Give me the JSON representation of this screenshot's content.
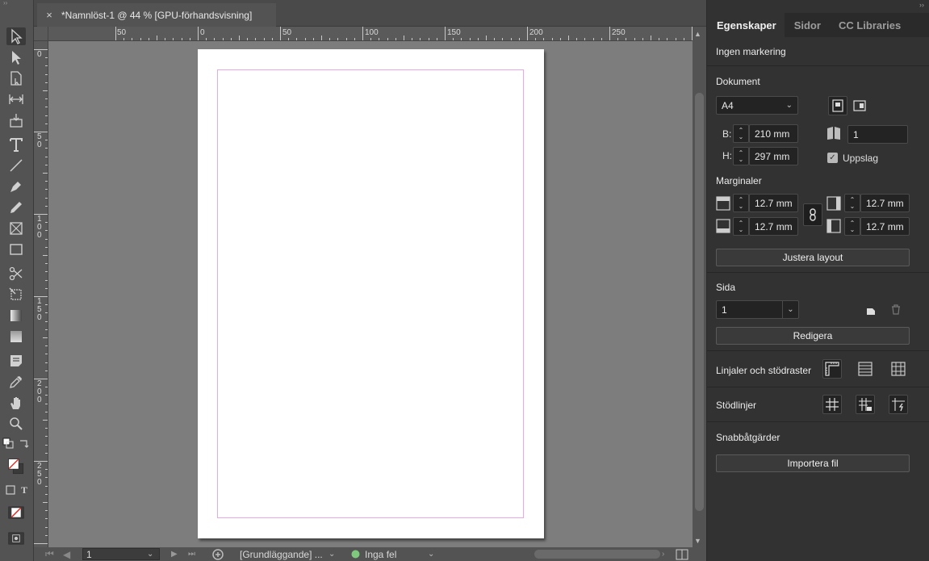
{
  "document_tab": {
    "close_label": "×",
    "title": "*Namnlöst-1 @ 44 % [GPU-förhandsvisning]"
  },
  "ruler": {
    "h_labels": [
      "50",
      "0",
      "50",
      "100",
      "150",
      "200",
      "250"
    ],
    "v_labels": [
      "0",
      "5\n0",
      "1\n0\n0",
      "1\n5\n0",
      "2\n0\n0",
      "2\n5\n0"
    ]
  },
  "panel": {
    "collapse": "››",
    "tabs": [
      "Egenskaper",
      "Sidor",
      "CC Libraries"
    ],
    "selection": "Ingen markering",
    "document": {
      "title": "Dokument",
      "preset": "A4",
      "width_label": "B:",
      "width": "210 mm",
      "height_label": "H:",
      "height": "297 mm",
      "pages": "1",
      "facing_pages_label": "Uppslag",
      "facing_pages": true
    },
    "margins": {
      "title": "Marginaler",
      "top": "12.7 mm",
      "bottom": "12.7 mm",
      "left": "12.7 mm",
      "right": "12.7 mm",
      "adjust_layout": "Justera layout"
    },
    "page": {
      "title": "Sida",
      "current": "1",
      "edit": "Redigera"
    },
    "rulers_grids": "Linjaler och stödraster",
    "guides": "Stödlinjer",
    "quick_actions": {
      "title": "Snabbåtgärder",
      "import": "Importera fil"
    }
  },
  "status": {
    "page": "1",
    "profile": "[Grundläggande] ...",
    "preflight": "Inga fel",
    "preflight_color": "#7fc97f"
  },
  "colors": {
    "accent_margin": "#e9a8e6",
    "canvas": "#7d7d7d",
    "panel": "#323232"
  }
}
